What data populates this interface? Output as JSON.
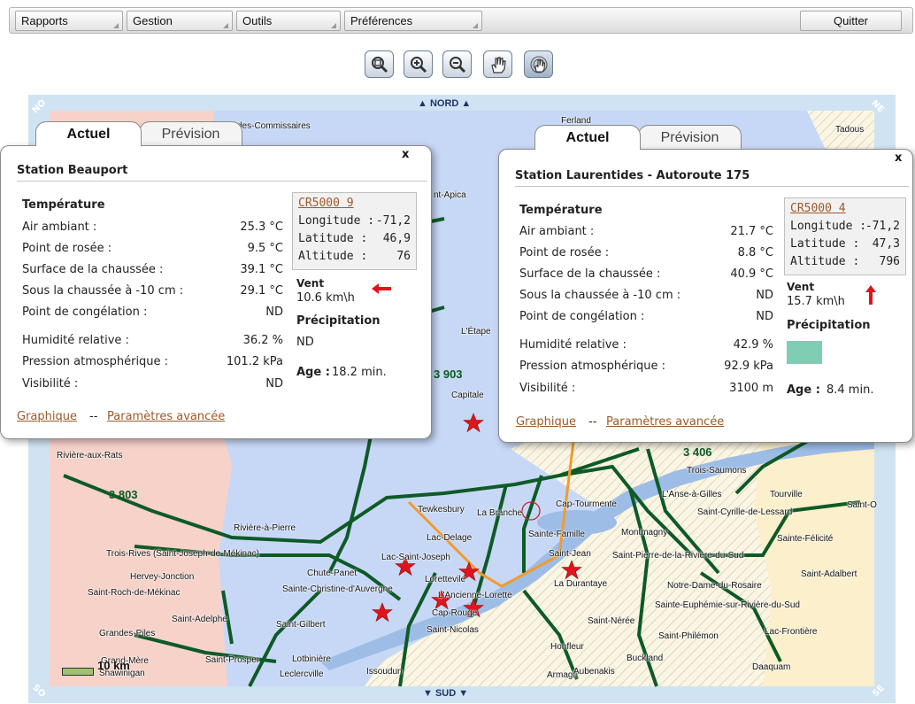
{
  "menu": {
    "rapports": "Rapports",
    "gestion": "Gestion",
    "outils": "Outils",
    "preferences": "Préférences",
    "quitter": "Quitter"
  },
  "map": {
    "north": "NORD",
    "south": "SUD",
    "corners": {
      "nw": "NO",
      "ne": "NE",
      "sw": "SO",
      "se": "SE"
    },
    "scale": "10 km",
    "regions": [
      "3 903",
      "3 803",
      "3 406"
    ],
    "places": [
      "des-Commissaires",
      "Ferland",
      "Tadous",
      "nt-Apica",
      "L'Étape",
      "Capitale",
      "Rivière-aux-Rats",
      "Trois-Saumons",
      "L'Anse-à-Gilles",
      "Tourville",
      "Saint-Cyrille-de-Lessard",
      "Saint-O",
      "Tewkesbury",
      "La Branche",
      "Cap-Tourmente",
      "Rivière-à-Pierre",
      "Lac-Delage",
      "Sainte-Famille",
      "Montmagny",
      "Sainte-Félicité",
      "Trois-Rives (Saint-Joseph-de-Mékinac)",
      "Lac-Saint-Joseph",
      "Saint-Jean",
      "Saint-Pierre-de-la-Rivière-du-Sud",
      "Hervey-Jonction",
      "Chute-Panet",
      "Lorettevile",
      "Saint-Adalbert",
      "Saint-Roch-de-Mékinac",
      "Sainte-Christine-d'Auvergne",
      "L'Ancienne-Lorette",
      "La Durantaye",
      "Notre-Dame-du-Rosaire",
      "Sainte-Euphémie-sur-Rivière-du-Sud",
      "Saint-Adelphe",
      "Saint-Gilbert",
      "Cap-Rouge",
      "Saint-Nérée",
      "Grandes-Piles",
      "Saint-Nicolas",
      "Lac-Frontière",
      "Saint-Philémon",
      "Honfleur",
      "Grand-Mère",
      "Saint-Prosper",
      "Lotbinière",
      "Buckland",
      "Shawinigan",
      "Leclercville",
      "Issoudun",
      "Armagh",
      "Daaquam",
      "Aubenakis"
    ]
  },
  "popup_left": {
    "tab_active": "Actuel",
    "tab_inactive": "Prévision",
    "close": "x",
    "station_name": "Station Beauport",
    "section_temp": "Température",
    "rows": [
      {
        "label": "Air ambiant :",
        "value": "25.3 °C"
      },
      {
        "label": "Point de rosée :",
        "value": "9.5 °C"
      },
      {
        "label": "Surface de la chaussée :",
        "value": "39.1 °C"
      },
      {
        "label": "Sous la chaussée à -10 cm :",
        "value": "29.1 °C"
      },
      {
        "label": "Point de congélation :",
        "value": "ND"
      },
      {
        "label": "Humidité relative :",
        "value": "36.2 %"
      },
      {
        "label": "Pression atmosphérique :",
        "value": "101.2 kPa"
      },
      {
        "label": "Visibilité :",
        "value": "ND"
      }
    ],
    "station_id": "CR5000 9",
    "longitude_label": "Longitude :",
    "longitude": "-71,2",
    "latitude_label": "Latitude :",
    "latitude": "46,9",
    "altitude_label": "Altitude :",
    "altitude": "76",
    "wind_label": "Vent",
    "wind_value": "10.6 km\\h",
    "wind_arrow": "arrow-left-icon",
    "precip_label": "Précipitation",
    "precip_value": "ND",
    "age_label": "Age :",
    "age_value": "18.2 min.",
    "link_graph": "Graphique",
    "link_sep": "--",
    "link_params": "Paramètres avancée"
  },
  "popup_right": {
    "tab_active": "Actuel",
    "tab_inactive": "Prévision",
    "close": "x",
    "station_name": "Station Laurentides - Autoroute 175",
    "section_temp": "Température",
    "rows": [
      {
        "label": "Air ambiant :",
        "value": "21.7 °C"
      },
      {
        "label": "Point de rosée :",
        "value": "8.8 °C"
      },
      {
        "label": "Surface de la chaussée :",
        "value": "40.9 °C"
      },
      {
        "label": "Sous la chaussée à -10 cm :",
        "value": "ND"
      },
      {
        "label": "Point de congélation :",
        "value": "ND"
      },
      {
        "label": "Humidité relative :",
        "value": "42.9 %"
      },
      {
        "label": "Pression atmosphérique :",
        "value": "92.9 kPa"
      },
      {
        "label": "Visibilité :",
        "value": "3100 m"
      }
    ],
    "station_id": "CR5000 4",
    "longitude_label": "Longitude :",
    "longitude": "-71,2",
    "latitude_label": "Latitude :",
    "latitude": "47,3",
    "altitude_label": "Altitude :",
    "altitude": "796",
    "wind_label": "Vent",
    "wind_value": "15.7 km\\h",
    "wind_arrow": "arrow-up-icon",
    "precip_label": "Précipitation",
    "precip_color": "#7fcdb3",
    "age_label": "Age :",
    "age_value": "8.4 min.",
    "link_graph": "Graphique",
    "link_sep": "--",
    "link_params": "Paramètres avancée"
  },
  "colors": {
    "accent_link": "#9a5a2a",
    "road": "#0e5a27",
    "water": "#bcd3ef",
    "station_marker": "#e0151b"
  }
}
